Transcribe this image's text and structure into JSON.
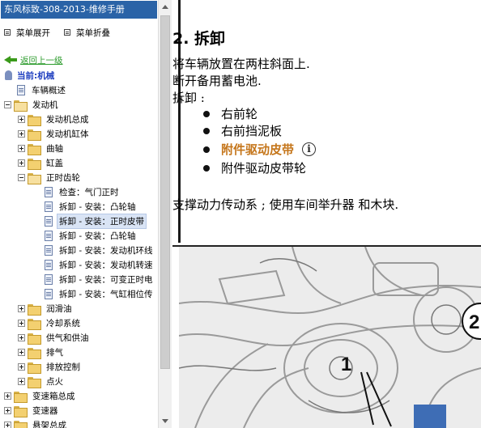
{
  "sidebar": {
    "title": "东风标致-308-2013-维修手册",
    "expand_all": "菜单展开",
    "collapse_all": "菜单折叠",
    "back_link": "返回上一级",
    "current": "当前:机械",
    "tree": [
      {
        "label": "车辆概述",
        "kind": "doc"
      },
      {
        "label": "发动机",
        "kind": "folder-open"
      },
      {
        "label": "发动机总成",
        "kind": "folder-closed"
      },
      {
        "label": "发动机缸体",
        "kind": "folder-closed"
      },
      {
        "label": "曲轴",
        "kind": "folder-closed"
      },
      {
        "label": "缸盖",
        "kind": "folder-closed"
      },
      {
        "label": "正时齿轮",
        "kind": "folder-open"
      },
      {
        "label": "检查：气门正时",
        "kind": "doc"
      },
      {
        "label": "拆卸 - 安装：凸轮轴",
        "kind": "doc"
      },
      {
        "label": "拆卸 - 安装：正时皮带",
        "kind": "doc",
        "selected": true
      },
      {
        "label": "拆卸 - 安装：凸轮轴",
        "kind": "doc"
      },
      {
        "label": "拆卸 - 安装：发动机环线",
        "kind": "doc"
      },
      {
        "label": "拆卸 - 安装：发动机转速",
        "kind": "doc"
      },
      {
        "label": "拆卸 - 安装：可变正时电",
        "kind": "doc"
      },
      {
        "label": "拆卸 - 安装：气缸相位传",
        "kind": "doc"
      },
      {
        "label": "润滑油",
        "kind": "folder-closed"
      },
      {
        "label": "冷却系统",
        "kind": "folder-closed"
      },
      {
        "label": "供气和供油",
        "kind": "folder-closed"
      },
      {
        "label": "排气",
        "kind": "folder-closed"
      },
      {
        "label": "排放控制",
        "kind": "folder-closed"
      },
      {
        "label": "点火",
        "kind": "folder-closed"
      },
      {
        "label": "变速箱总成",
        "kind": "folder-closed"
      },
      {
        "label": "变速器",
        "kind": "folder-closed"
      },
      {
        "label": "悬架总成",
        "kind": "folder-closed"
      }
    ]
  },
  "content": {
    "section_title": "2. 拆卸",
    "lines": [
      "将车辆放置在两柱斜面上.",
      "断开备用蓄电池.",
      "拆卸 :"
    ],
    "bullets": [
      {
        "text": "右前轮",
        "link": false
      },
      {
        "text": "右前挡泥板",
        "link": false
      },
      {
        "text": "附件驱动皮带",
        "link": true,
        "icon": "info-icon"
      },
      {
        "text": "附件驱动皮带轮",
        "link": false
      }
    ],
    "support_line": "支撑动力传动系 ; 使用车间举升器  和木块.",
    "figure_callouts": [
      "1",
      "2"
    ]
  },
  "colors": {
    "title_bar": "#2a63a7",
    "back_link": "#2b9b2b",
    "current": "#1f3fc0",
    "link_bullet": "#c5761b"
  }
}
